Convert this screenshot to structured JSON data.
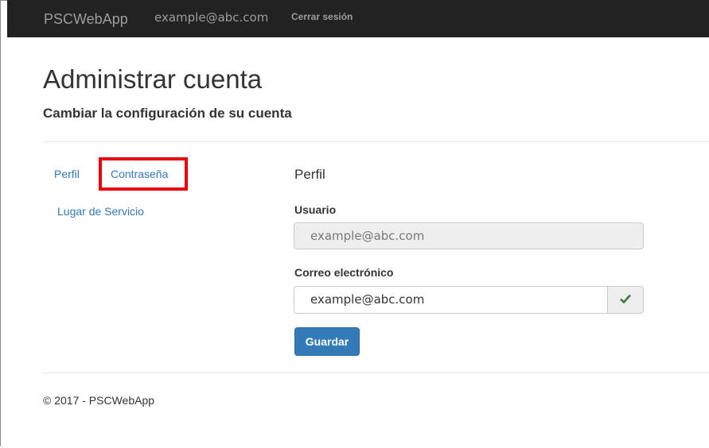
{
  "navbar": {
    "brand": "PSCWebApp",
    "user_email": "example@abc.com",
    "logout_label": "Cerrar sesión"
  },
  "header": {
    "title": "Administrar cuenta",
    "subtitle": "Cambiar la configuración de su cuenta"
  },
  "sidebar": {
    "items": [
      {
        "label": "Perfil"
      },
      {
        "label": "Contraseña"
      },
      {
        "label": "Lugar de Servicio"
      }
    ],
    "highlight_color": "#e8000b"
  },
  "main": {
    "section_title": "Perfil",
    "username_label": "Usuario",
    "username_value": "example@abc.com",
    "email_label": "Correo electrónico",
    "email_value": "example@abc.com",
    "email_status_icon": "checkmark-icon",
    "save_label": "Guardar"
  },
  "footer": {
    "copyright": "© 2017 - PSCWebApp"
  },
  "colors": {
    "navbar_bg": "#222222",
    "link": "#337ab7",
    "primary_button": "#337ab7",
    "check": "#3c763d"
  }
}
